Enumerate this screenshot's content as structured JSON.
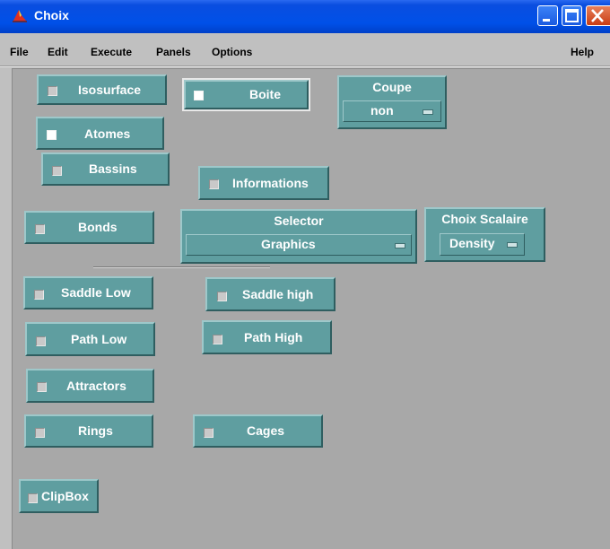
{
  "window": {
    "title": "Choix",
    "controls": [
      "minimize-icon",
      "maximize-icon",
      "close-icon"
    ],
    "colors": {
      "titlebar": "#0050e8",
      "panel": "#a8a8a8",
      "button": "#5f9ea0"
    }
  },
  "menubar": {
    "file": "File",
    "edit": "Edit",
    "execute": "Execute",
    "panels": "Panels",
    "options": "Options",
    "help": "Help"
  },
  "toggles": {
    "isosurface": {
      "label": "Isosurface",
      "checked": false
    },
    "boite": {
      "label": "Boite",
      "checked": true
    },
    "atomes": {
      "label": "Atomes",
      "checked": true
    },
    "bassins": {
      "label": "Bassins",
      "checked": false
    },
    "informations": {
      "label": "Informations",
      "checked": false
    },
    "bonds": {
      "label": "Bonds",
      "checked": false
    },
    "saddle_low": {
      "label": "Saddle Low",
      "checked": false
    },
    "saddle_high": {
      "label": "Saddle high",
      "checked": false
    },
    "path_low": {
      "label": "Path Low",
      "checked": false
    },
    "path_high": {
      "label": "Path High",
      "checked": false
    },
    "attractors": {
      "label": "Attractors",
      "checked": false
    },
    "rings": {
      "label": "Rings",
      "checked": false
    },
    "cages": {
      "label": "Cages",
      "checked": false
    },
    "clipbox": {
      "label": "ClipBox",
      "checked": false
    }
  },
  "options": {
    "coupe": {
      "label": "Coupe",
      "value": "non"
    },
    "selector": {
      "label": "Selector",
      "value": "Graphics"
    },
    "choix_scalaire": {
      "label": "Choix Scalaire",
      "value": "Density"
    }
  }
}
